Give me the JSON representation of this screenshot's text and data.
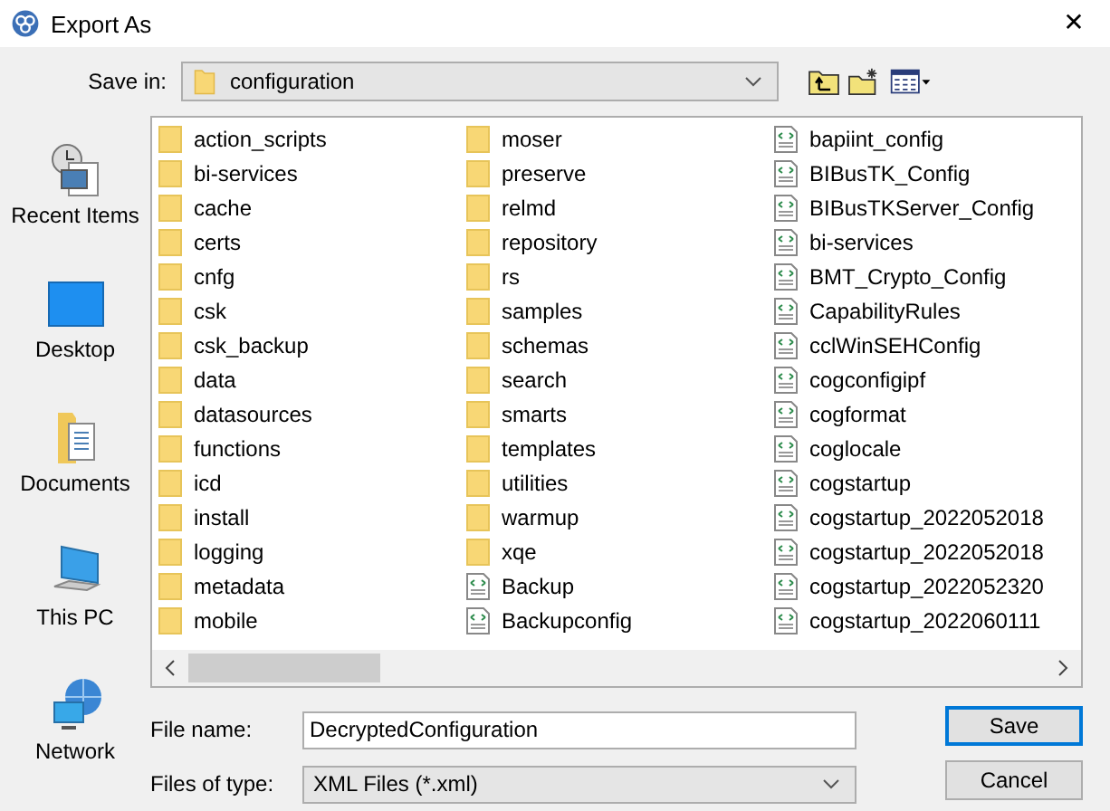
{
  "window": {
    "title": "Export As",
    "close": "✕"
  },
  "save_in": {
    "label": "Save in:",
    "value": "configuration"
  },
  "places": [
    {
      "label": "Recent Items",
      "kind": "recent"
    },
    {
      "label": "Desktop",
      "kind": "desktop"
    },
    {
      "label": "Documents",
      "kind": "documents"
    },
    {
      "label": "This PC",
      "kind": "pc"
    },
    {
      "label": "Network",
      "kind": "network"
    }
  ],
  "files": [
    {
      "name": "action_scripts",
      "kind": "folder"
    },
    {
      "name": "bi-services",
      "kind": "folder"
    },
    {
      "name": "cache",
      "kind": "folder"
    },
    {
      "name": "certs",
      "kind": "folder"
    },
    {
      "name": "cnfg",
      "kind": "folder"
    },
    {
      "name": "csk",
      "kind": "folder"
    },
    {
      "name": "csk_backup",
      "kind": "folder"
    },
    {
      "name": "data",
      "kind": "folder"
    },
    {
      "name": "datasources",
      "kind": "folder"
    },
    {
      "name": "functions",
      "kind": "folder"
    },
    {
      "name": "icd",
      "kind": "folder"
    },
    {
      "name": "install",
      "kind": "folder"
    },
    {
      "name": "logging",
      "kind": "folder"
    },
    {
      "name": "metadata",
      "kind": "folder"
    },
    {
      "name": "mobile",
      "kind": "folder"
    },
    {
      "name": "moser",
      "kind": "folder"
    },
    {
      "name": "preserve",
      "kind": "folder"
    },
    {
      "name": "relmd",
      "kind": "folder"
    },
    {
      "name": "repository",
      "kind": "folder"
    },
    {
      "name": "rs",
      "kind": "folder"
    },
    {
      "name": "samples",
      "kind": "folder"
    },
    {
      "name": "schemas",
      "kind": "folder"
    },
    {
      "name": "search",
      "kind": "folder"
    },
    {
      "name": "smarts",
      "kind": "folder"
    },
    {
      "name": "templates",
      "kind": "folder"
    },
    {
      "name": "utilities",
      "kind": "folder"
    },
    {
      "name": "warmup",
      "kind": "folder"
    },
    {
      "name": "xqe",
      "kind": "folder"
    },
    {
      "name": "Backup",
      "kind": "file"
    },
    {
      "name": "Backupconfig",
      "kind": "file"
    },
    {
      "name": "bapiint_config",
      "kind": "file"
    },
    {
      "name": "BIBusTK_Config",
      "kind": "file"
    },
    {
      "name": "BIBusTKServer_Config",
      "kind": "file"
    },
    {
      "name": "bi-services",
      "kind": "file"
    },
    {
      "name": "BMT_Crypto_Config",
      "kind": "file"
    },
    {
      "name": "CapabilityRules",
      "kind": "file"
    },
    {
      "name": "cclWinSEHConfig",
      "kind": "file"
    },
    {
      "name": "cogconfigipf",
      "kind": "file"
    },
    {
      "name": "cogformat",
      "kind": "file"
    },
    {
      "name": "coglocale",
      "kind": "file"
    },
    {
      "name": "cogstartup",
      "kind": "file"
    },
    {
      "name": "cogstartup_2022052018",
      "kind": "file"
    },
    {
      "name": "cogstartup_2022052018",
      "kind": "file"
    },
    {
      "name": "cogstartup_2022052320",
      "kind": "file"
    },
    {
      "name": "cogstartup_2022060111",
      "kind": "file"
    }
  ],
  "file_name": {
    "label": "File name:",
    "value": "DecryptedConfiguration"
  },
  "file_type": {
    "label": "Files of type:",
    "value": "XML Files (*.xml)"
  },
  "buttons": [
    {
      "label": "Save",
      "default": true
    },
    {
      "label": "Cancel",
      "default": false
    }
  ]
}
